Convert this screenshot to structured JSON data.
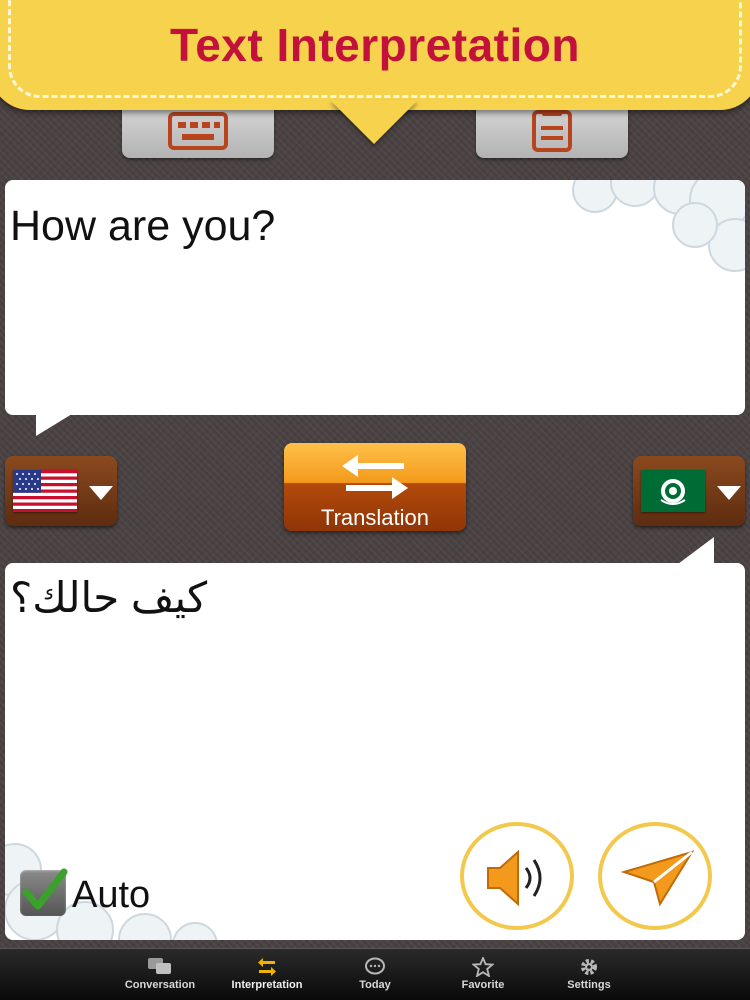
{
  "header": {
    "title": "Text Interpretation"
  },
  "source": {
    "text": "How are you?",
    "language_flag": "us-flag-icon"
  },
  "target": {
    "text": "كيف حالك؟",
    "language_flag": "arab-league-flag-icon"
  },
  "translate_button": {
    "label": "Translation"
  },
  "auto": {
    "label": "Auto",
    "checked": true
  },
  "nav": {
    "items": [
      {
        "label": "Conversation",
        "icon": "chat-bubbles-icon",
        "active": false
      },
      {
        "label": "Interpretation",
        "icon": "swap-arrows-icon",
        "active": true
      },
      {
        "label": "Today",
        "icon": "speech-bubble-icon",
        "active": false
      },
      {
        "label": "Favorite",
        "icon": "star-icon",
        "active": false
      },
      {
        "label": "Settings",
        "icon": "gear-icon",
        "active": false
      }
    ]
  },
  "colors": {
    "banner": "#f6d24d",
    "title": "#c2123c",
    "accent_orange": "#f39a1c",
    "active_nav_icon": "#f0b400"
  }
}
